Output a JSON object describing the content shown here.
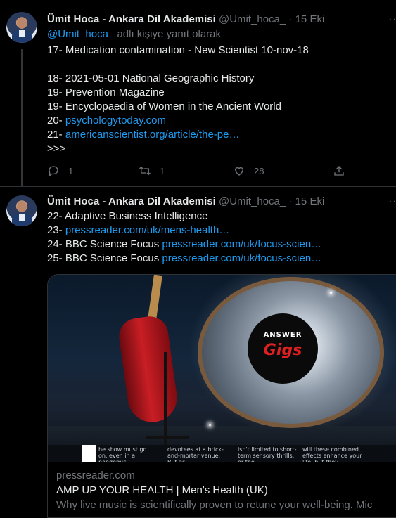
{
  "tweet1": {
    "author": {
      "name": "Ümit Hoca - Ankara Dil Akademisi",
      "handle": "@Umit_hoca_",
      "separator": "·",
      "date": "15 Eki"
    },
    "reply_to": {
      "handle": "@Umit_hoca_",
      "text": " adlı kişiye yanıt olarak"
    },
    "lines": [
      {
        "text": "17- Medication  contamination - New Scientist 10-nov-18",
        "link": ""
      },
      {
        "text": "18- 2021-05-01 National Geographic History",
        "link": ""
      },
      {
        "text": "19- Prevention Magazine",
        "link": ""
      },
      {
        "text": "19- Encyclopaedia of Women in the Ancient World",
        "link": ""
      },
      {
        "text": "20- ",
        "link": "psychologytoday.com"
      },
      {
        "text": "21- ",
        "link": "americanscientist.org/article/the-pe…"
      },
      {
        "text": ">>>",
        "link": ""
      }
    ],
    "actions": {
      "replies": "1",
      "retweets": "1",
      "likes": "28"
    }
  },
  "tweet2": {
    "author": {
      "name": "Ümit Hoca - Ankara Dil Akademisi",
      "handle": "@Umit_hoca_",
      "separator": "·",
      "date": "15 Eki"
    },
    "lines": [
      {
        "text": "22- Adaptive Business Intelligence",
        "link": ""
      },
      {
        "text": "23- ",
        "link": "pressreader.com/uk/mens-health…"
      },
      {
        "text": "24- BBC Science Focus ",
        "link": "pressreader.com/uk/focus-scien…"
      },
      {
        "text": "25- BBC Science Focus ",
        "link": "pressreader.com/uk/focus-scien…"
      }
    ],
    "card": {
      "image_text": {
        "answer": "ANSWER",
        "gigs": "Gigs",
        "col1": "he show must go on, even in a pandemic.",
        "col2": "devotees at a brick-and-mortar venue. But as",
        "col3": "isn't limited to short-term sensory thrills, or the",
        "col4": "will these combined effects enhance your life, but they"
      },
      "domain": "pressreader.com",
      "title": "AMP UP YOUR HEALTH | Men's Health (UK)",
      "description": "Why live music is scientifically proven to retune your well-being. Mic"
    }
  },
  "icons": {
    "more": "more-icon",
    "reply": "reply-icon",
    "retweet": "retweet-icon",
    "like": "like-icon",
    "share": "share-icon"
  },
  "colors": {
    "background": "#000000",
    "text": "#e7e9ea",
    "muted": "#71767b",
    "link": "#1d9bf0",
    "border": "#2f3336"
  }
}
